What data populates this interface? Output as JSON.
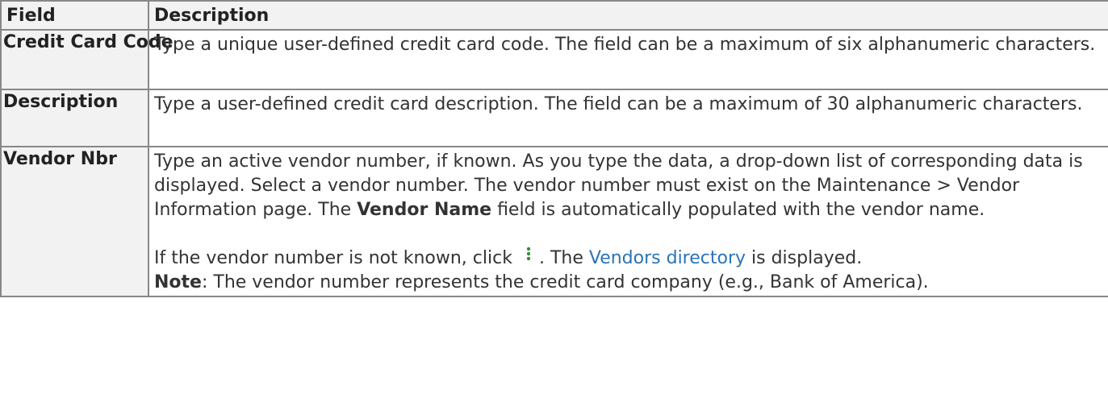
{
  "table": {
    "headers": {
      "field": "Field",
      "description": "Description"
    },
    "rows": [
      {
        "field": "Credit Card Code",
        "description": "Type a unique user-defined credit card code. The field can be a maximum of six alphanumeric characters."
      },
      {
        "field": "Description",
        "description": "Type a user-defined credit card description. The field can be a maximum of 30 alphanumeric characters."
      },
      {
        "field": "Vendor Nbr",
        "para1_before": "Type an active vendor number, if known. As you type the data, a drop-down list of corresponding data is displayed. Select a vendor number. The vendor number must exist on the Maintenance > Vendor Information page. The ",
        "para1_bold": "Vendor Name",
        "para1_after": " field is automatically populated with the vendor name.",
        "para2_before": "If the vendor number is not known, click ",
        "para2_icon": "three-dots-vertical-icon",
        "para2_middle": ". The ",
        "para2_link": "Vendors directory",
        "para2_after": " is displayed.",
        "para3_bold": "Note",
        "para3_after": ": The vendor number represents the credit card company (e.g., Bank of America)."
      }
    ]
  },
  "colors": {
    "header_bg": "#f2f2f2",
    "border": "#888888",
    "link": "#2b73b7",
    "icon": "#3a8a3a"
  }
}
